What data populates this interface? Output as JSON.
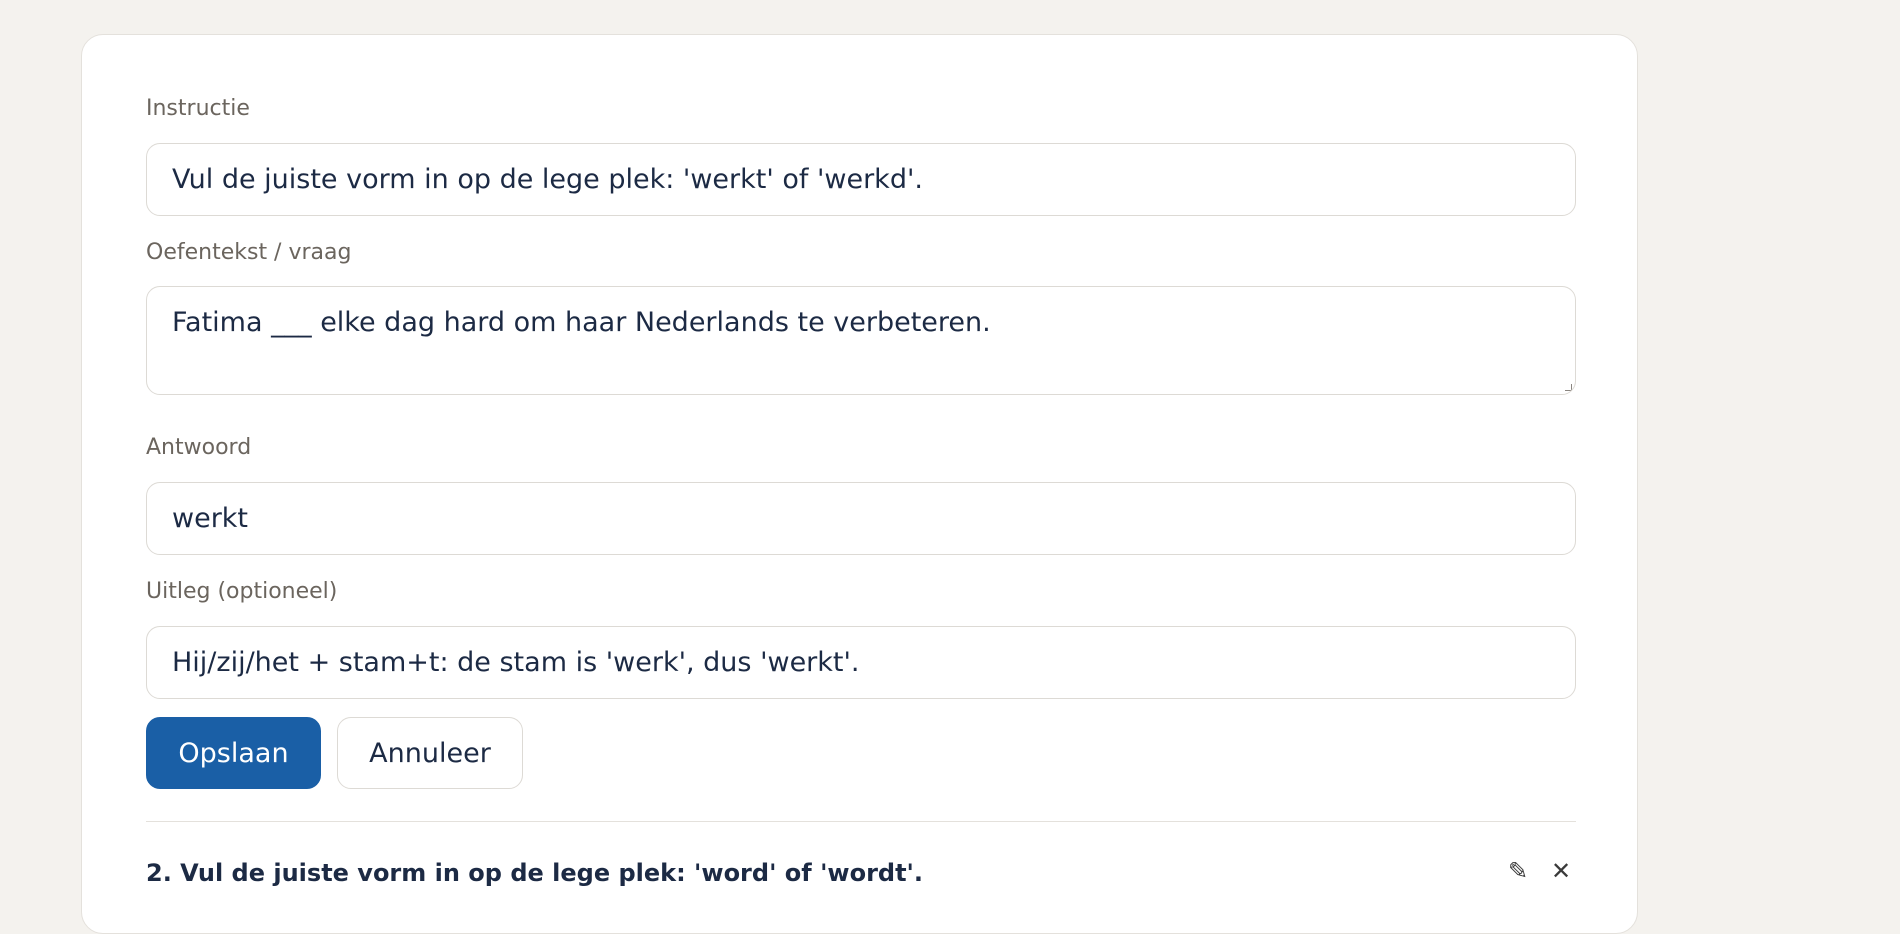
{
  "form": {
    "instruction_label": "Instructie",
    "instruction_value": "Vul de juiste vorm in op de lege plek: 'werkt' of 'werkd'.",
    "question_label": "Oefentekst / vraag",
    "question_value": "Fatima ___ elke dag hard om haar Nederlands te verbeteren.",
    "answer_label": "Antwoord",
    "answer_value": "werkt",
    "explanation_label": "Uitleg (optioneel)",
    "explanation_value": "Hij/zij/het + stam+t: de stam is 'werk', dus 'werkt'.",
    "save_label": "Opslaan",
    "cancel_label": "Annuleer"
  },
  "next_item": {
    "title": "2. Vul de juiste vorm in op de lege plek: 'word' of 'wordt'.",
    "edit_icon": "pencil-icon",
    "delete_icon": "close-icon"
  },
  "colors": {
    "page_background": "#f4f2ee",
    "primary_button": "#1a5fa6",
    "text": "#1c2a44",
    "label": "#6b655e"
  }
}
